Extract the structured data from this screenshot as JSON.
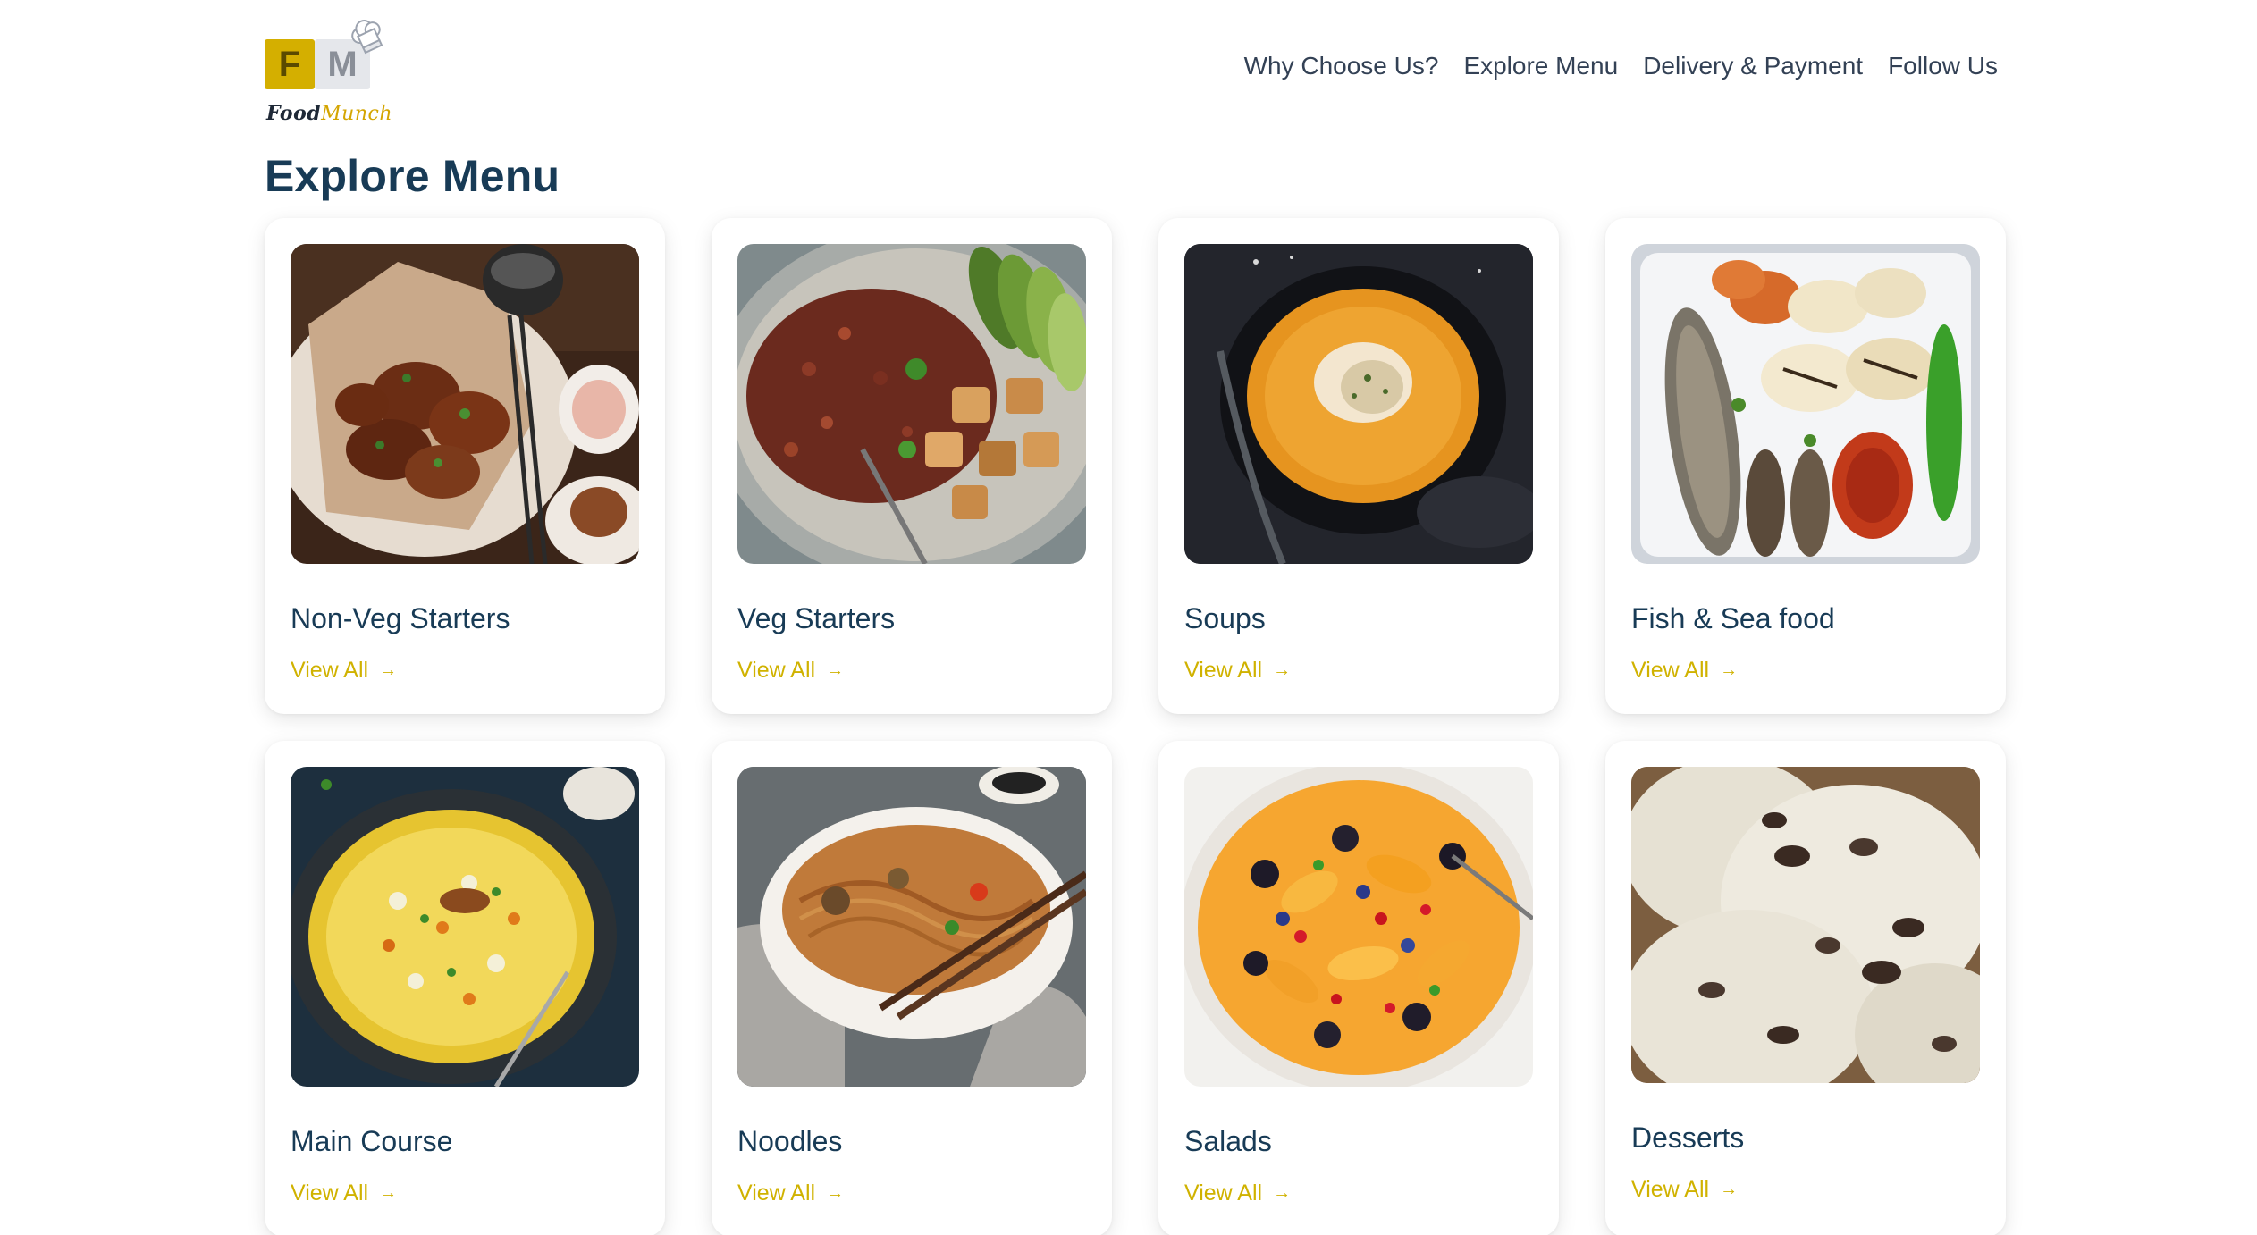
{
  "brand": {
    "logo_letter_1": "F",
    "logo_letter_2": "M",
    "name_part_1": "Food",
    "name_part_2": "Munch",
    "accent_color": "#d4af00"
  },
  "nav": {
    "items": [
      {
        "label": "Why Choose Us?"
      },
      {
        "label": "Explore Menu"
      },
      {
        "label": "Delivery & Payment"
      },
      {
        "label": "Follow Us"
      }
    ]
  },
  "main": {
    "title": "Explore Menu",
    "title_color": "#183b56",
    "link_color": "#d0b200",
    "cards": [
      {
        "title": "Non-Veg Starters",
        "link": "View All",
        "arrow": "→",
        "image": "fried-chicken-image"
      },
      {
        "title": "Veg Starters",
        "link": "View All",
        "arrow": "→",
        "image": "veg-bowl-image"
      },
      {
        "title": "Soups",
        "link": "View All",
        "arrow": "→",
        "image": "soup-image"
      },
      {
        "title": "Fish & Sea food",
        "link": "View All",
        "arrow": "→",
        "image": "seafood-platter-image"
      },
      {
        "title": "Main Course",
        "link": "View All",
        "arrow": "→",
        "image": "biryani-image"
      },
      {
        "title": "Noodles",
        "link": "View All",
        "arrow": "→",
        "image": "noodles-image"
      },
      {
        "title": "Salads",
        "link": "View All",
        "arrow": "→",
        "image": "fruit-salad-image"
      },
      {
        "title": "Desserts",
        "link": "View All",
        "arrow": "→",
        "image": "ice-cream-image"
      }
    ]
  }
}
